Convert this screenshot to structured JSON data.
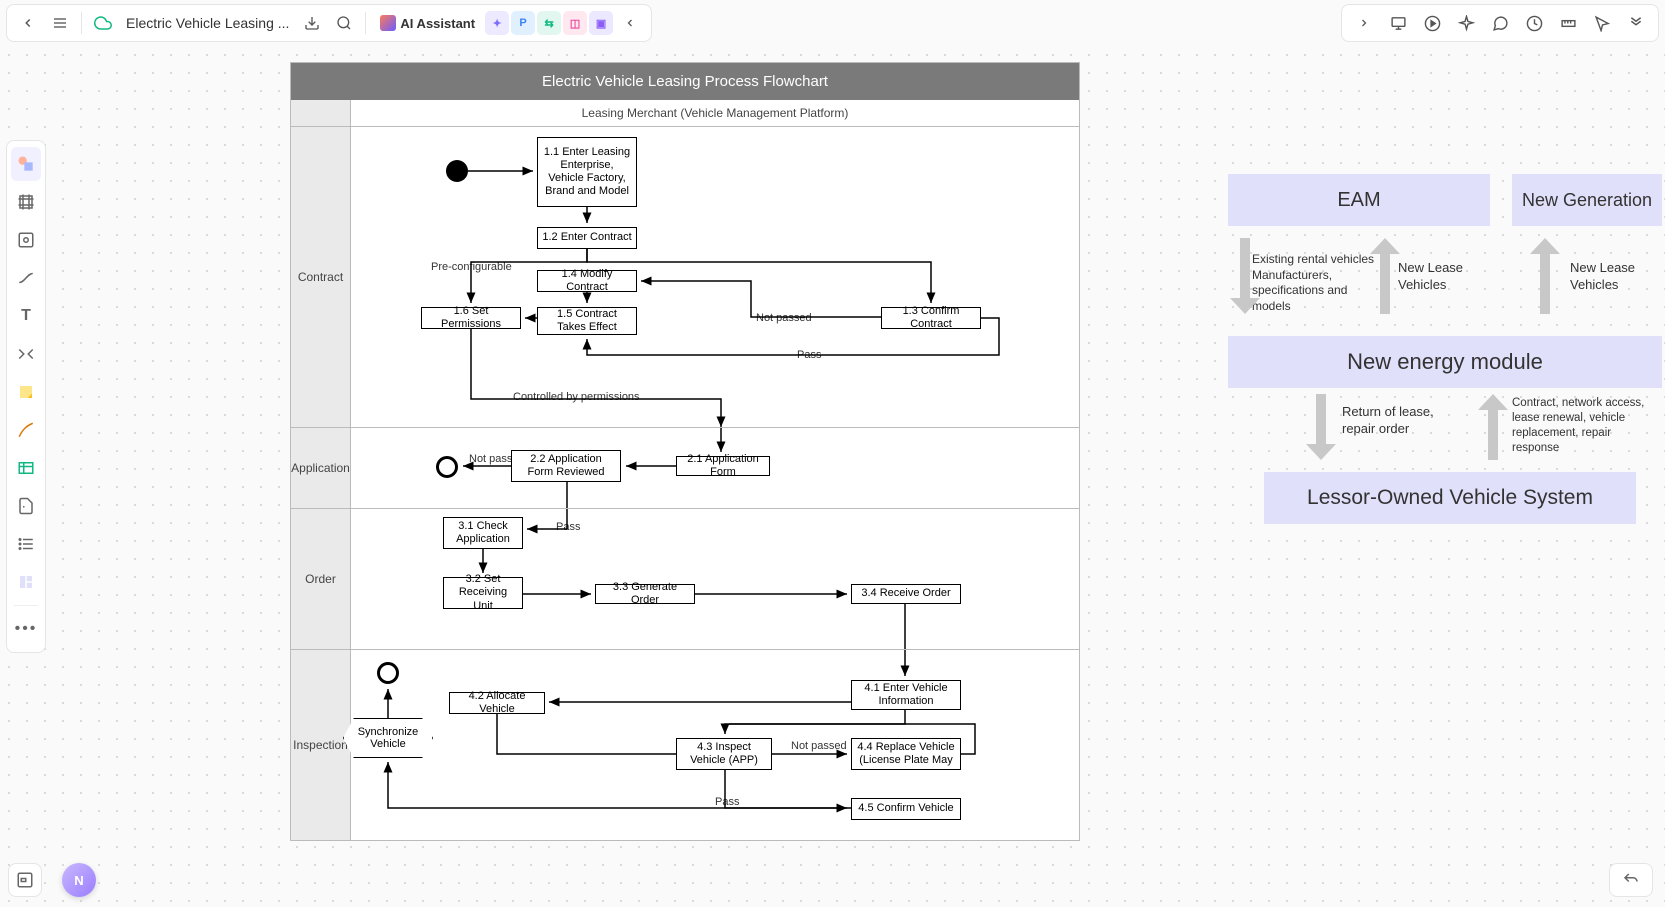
{
  "topbar": {
    "doc_title": "Electric Vehicle Leasing ...",
    "ai_label": "AI Assistant"
  },
  "flow": {
    "title": "Electric Vehicle Leasing Process Flowchart",
    "column_header": "Leasing Merchant (Vehicle Management Platform)",
    "lanes": {
      "contract": "Contract",
      "application": "Application",
      "order": "Order",
      "inspection": "Inspection"
    },
    "boxes": {
      "b11": "1.1 Enter Leasing Enterprise, Vehicle Factory, Brand and Model",
      "b12": "1.2 Enter Contract",
      "b13": "1.3 Confirm Contract",
      "b14": "1.4 Modify Contract",
      "b15": "1.5 Contract Takes Effect",
      "b16": "1.6 Set Permissions",
      "b21": "2.1 Application Form",
      "b22": "2.2 Application Form Reviewed",
      "b31": "3.1 Check Application",
      "b32": "3.2 Set Receiving Unit",
      "b33": "3.3 Generate Order",
      "b34": "3.4 Receive Order",
      "b41": "4.1 Enter Vehicle Information",
      "b42": "4.2 Allocate Vehicle",
      "b43": "4.3 Inspect Vehicle (APP)",
      "b44": "4.4 Replace Vehicle (License Plate May",
      "b45": "4.5 Confirm Vehicle",
      "sync": "Synchronize Vehicle"
    },
    "labels": {
      "preconfig": "Pre-configurable",
      "notpassed": "Not passed",
      "pass": "Pass",
      "controlled": "Controlled by permissions",
      "notpassed2": "Not passed",
      "pass2": "Pass",
      "notpassed3": "Not passed",
      "pass3": "Pass"
    }
  },
  "right": {
    "eam": "EAM",
    "newgen": "New Generation",
    "module": "New energy module",
    "lessor": "Lessor-Owned Vehicle System",
    "lbl1": "Existing rental vehicles Manufacturers, specifications and models",
    "lbl2": "New Lease Vehicles",
    "lbl3": "New Lease Vehicles",
    "lbl4": "Return of lease, repair order",
    "lbl5": "Contract, network access, lease renewal, vehicle replacement, repair response"
  }
}
